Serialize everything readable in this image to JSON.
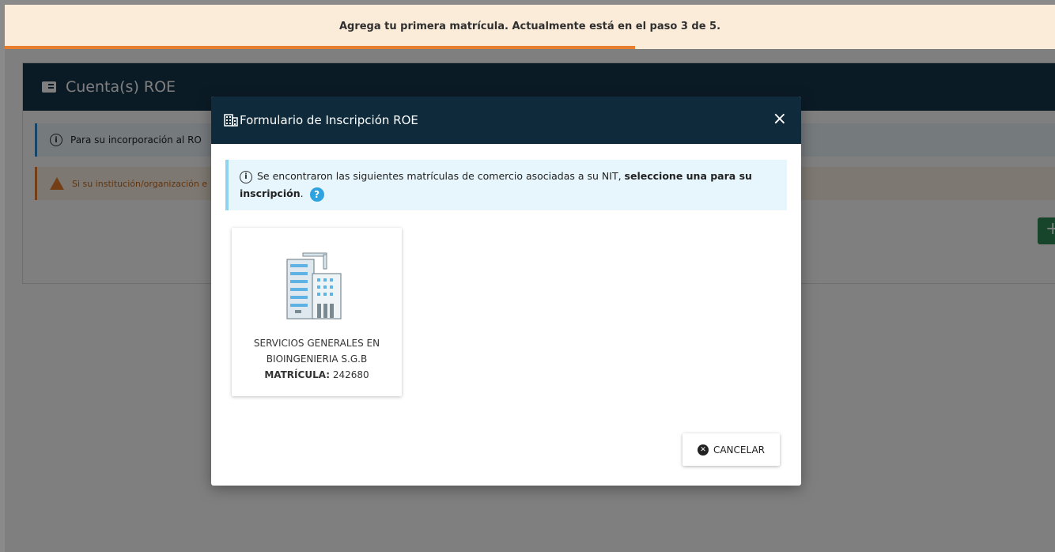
{
  "banner": {
    "text": "Agrega tu primera matrícula. Actualmente está en el paso 3 de 5.",
    "progress_fraction": 0.6
  },
  "page": {
    "card_title": "Cuenta(s) ROE",
    "info_text": "Para su incorporación al RO",
    "warn_text": "Si su institución/organización e",
    "add_label": "+"
  },
  "modal": {
    "title": "Formulario de Inscripción ROE",
    "close_label": "×",
    "alert_normal": "Se encontraron las siguientes matrículas de comercio asociadas a su NIT, ",
    "alert_bold": "seleccione una para su inscripción",
    "alert_end": ".",
    "help_label": "?",
    "companies": [
      {
        "name": "SERVICIOS GENERALES EN BIOINGENIERIA S.G.B",
        "matricula_label": "MATRÍCULA:",
        "matricula_value": "242680"
      }
    ],
    "cancel_label": "CANCELAR"
  },
  "colors": {
    "header_dark": "#0f2a3b",
    "progress": "#e87f2e",
    "info": "#2ea3e0"
  }
}
